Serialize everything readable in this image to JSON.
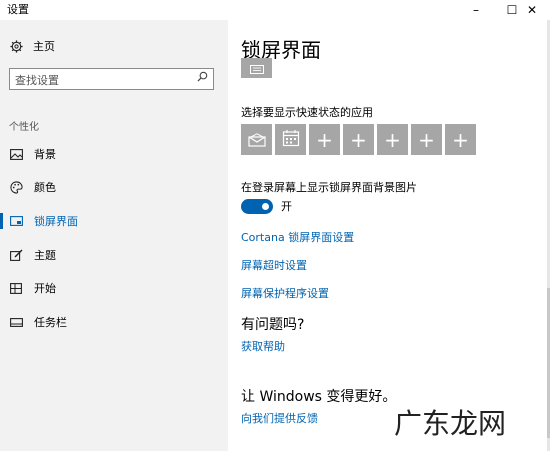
{
  "window": {
    "title": "设置",
    "minimize_glyph": "–",
    "maximize_glyph": "☐",
    "close_glyph": "✕"
  },
  "sidebar": {
    "home": {
      "icon": "gear-icon",
      "label": "主页"
    },
    "search": {
      "placeholder": "查找设置",
      "icon": "search-icon"
    },
    "group_label": "个性化",
    "items": [
      {
        "icon": "picture-icon",
        "label": "背景",
        "active": false
      },
      {
        "icon": "palette-icon",
        "label": "颜色",
        "active": false
      },
      {
        "icon": "lock-screen-icon",
        "label": "锁屏界面",
        "active": true
      },
      {
        "icon": "brush-icon",
        "label": "主题",
        "active": false
      },
      {
        "icon": "start-icon",
        "label": "开始",
        "active": false
      },
      {
        "icon": "taskbar-icon",
        "label": "任务栏",
        "active": false
      }
    ]
  },
  "main": {
    "title": "锁屏界面",
    "quick_status_label": "选择要显示快速状态的应用",
    "quick_tiles": [
      {
        "icon": "mail-icon"
      },
      {
        "icon": "calendar-icon"
      },
      {
        "icon": "plus-icon"
      },
      {
        "icon": "plus-icon"
      },
      {
        "icon": "plus-icon"
      },
      {
        "icon": "plus-icon"
      },
      {
        "icon": "plus-icon"
      }
    ],
    "signin_bg_label": "在登录屏幕上显示锁屏界面背景图片",
    "toggle": {
      "state": "on",
      "label": "开"
    },
    "links": {
      "cortana": "Cortana 锁屏界面设置",
      "timeout": "屏幕超时设置",
      "screensaver": "屏幕保护程序设置"
    },
    "question_heading": "有问题吗?",
    "get_help": "获取帮助",
    "better_heading": "让 Windows 变得更好。",
    "feedback": "向我们提供反馈"
  },
  "watermark": "广东龙网",
  "colors": {
    "accent": "#0063b1",
    "nav_bg": "#f2f2f2",
    "tile_bg": "#a6a6a6"
  }
}
